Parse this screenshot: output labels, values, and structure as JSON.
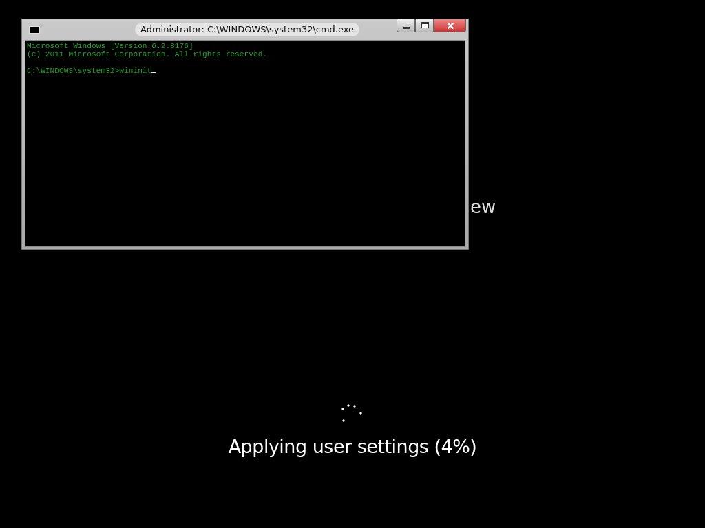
{
  "background_text": "ew",
  "window": {
    "title": "Administrator: C:\\WINDOWS\\system32\\cmd.exe",
    "console_blocks": [
      [
        "Microsoft Windows [Version 6.2.8176]",
        "(c) 2011 Microsoft Corporation. All rights reserved."
      ],
      [
        "C:\\WINDOWS\\system32>wininit"
      ]
    ]
  },
  "status": "Applying user settings (4%)"
}
